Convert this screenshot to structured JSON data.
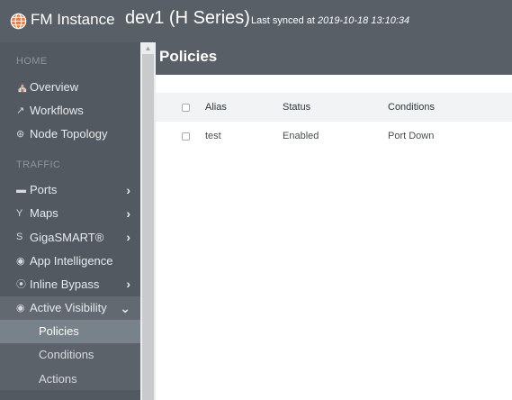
{
  "header": {
    "brand": "FM Instance",
    "instance": "dev1 (H Series)",
    "sync_prefix": "Last synced at ",
    "sync_time": "2019-10-18 13:10:34",
    "icon": "globe-icon"
  },
  "sidebar": {
    "sections": {
      "home": "HOME",
      "traffic": "TRAFFIC"
    },
    "items": [
      {
        "label": "Overview",
        "icon": "home-icon"
      },
      {
        "label": "Workflows",
        "icon": "workflow-icon"
      },
      {
        "label": "Node Topology",
        "icon": "topology-icon"
      },
      {
        "label": "Ports",
        "icon": "ports-icon"
      },
      {
        "label": "Maps",
        "icon": "maps-icon"
      },
      {
        "label": "GigaSMART®",
        "icon": "gigasmart-icon"
      },
      {
        "label": "App Intelligence",
        "icon": "app-intelligence-icon"
      },
      {
        "label": "Inline Bypass",
        "icon": "inline-bypass-icon"
      },
      {
        "label": "Active Visibility",
        "icon": "eye-icon"
      }
    ],
    "subitems": [
      {
        "label": "Policies"
      },
      {
        "label": "Conditions"
      },
      {
        "label": "Actions"
      }
    ]
  },
  "page": {
    "title": "Policies"
  },
  "table": {
    "columns": [
      "Alias",
      "Status",
      "Conditions"
    ],
    "rows": [
      {
        "alias": "test",
        "status": "Enabled",
        "conditions": "Port Down"
      }
    ]
  },
  "colors": {
    "topbar": "#585f67",
    "sidebar": "#535961",
    "selected": "#78828b",
    "globe": "#f07a3a"
  }
}
